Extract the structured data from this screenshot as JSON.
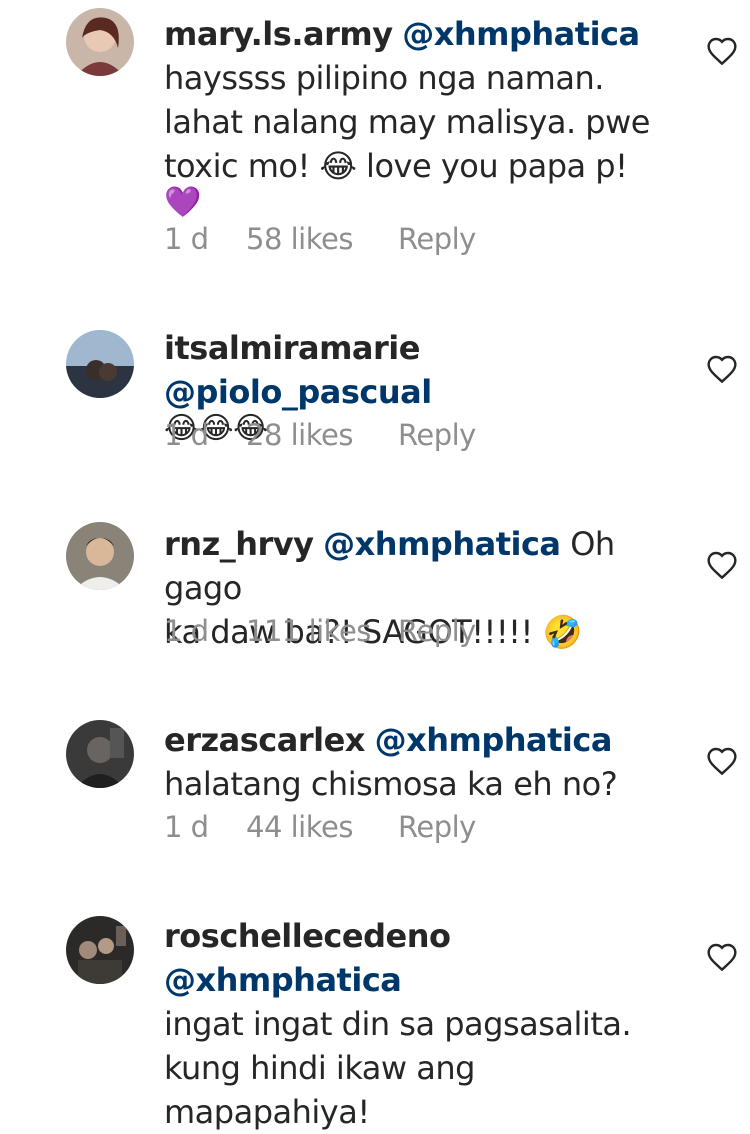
{
  "comments": [
    {
      "username": "mary.ls.army",
      "mention": "@xhmphatica",
      "lines": [
        "hayssss pilipino nga naman.",
        "lahat nalang may malisya. pwe",
        "toxic mo! 😂 love you papa p!",
        "💜"
      ],
      "time": "1 d",
      "likes": "58 likes",
      "reply": "Reply"
    },
    {
      "username": "itsalmiramarie",
      "mention": "@piolo_pascual",
      "lines": [
        "😂😂😂"
      ],
      "time": "1 d",
      "likes": "28 likes",
      "reply": "Reply"
    },
    {
      "username": "rnz_hrvy",
      "mention": "@xhmphatica",
      "inline_text": "Oh gago",
      "lines": [
        "ka daw ba?! SAGOT!!!!! 🤣"
      ],
      "time": "1 d",
      "likes": "111 likes",
      "reply": "Reply"
    },
    {
      "username": "erzascarlex",
      "mention": "@xhmphatica",
      "lines": [
        "halatang chismosa ka eh no?"
      ],
      "time": "1 d",
      "likes": "44 likes",
      "reply": "Reply"
    },
    {
      "username": "roschellecedeno",
      "mention": "@xhmphatica",
      "lines": [
        "ingat ingat din sa pagsasalita.",
        "kung hindi ikaw ang",
        "mapapahiya!"
      ],
      "time": "",
      "likes": "",
      "reply": ""
    }
  ],
  "colors": {
    "text": "#262626",
    "mention": "#00376b",
    "meta": "#8e8e8e"
  },
  "icons": {
    "like": "heart-outline-icon"
  }
}
